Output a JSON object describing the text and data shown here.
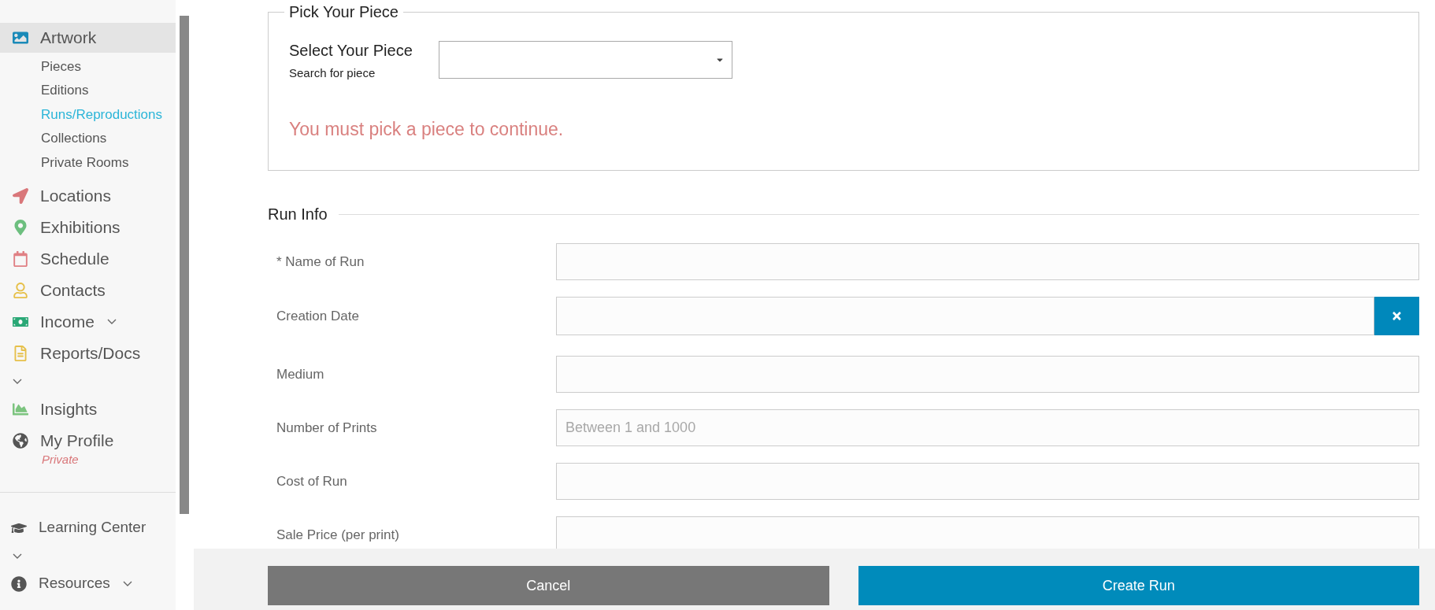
{
  "sidebar": {
    "items": [
      {
        "label": "Artwork",
        "selected": true,
        "expandable": false,
        "children": [
          {
            "label": "Pieces",
            "selected": false
          },
          {
            "label": "Editions",
            "selected": false
          },
          {
            "label": "Runs/Reproductions",
            "selected": true
          },
          {
            "label": "Collections",
            "selected": false
          },
          {
            "label": "Private Rooms",
            "selected": false
          }
        ]
      },
      {
        "label": "Locations",
        "selected": false,
        "expandable": false
      },
      {
        "label": "Exhibitions",
        "selected": false,
        "expandable": false
      },
      {
        "label": "Schedule",
        "selected": false,
        "expandable": false
      },
      {
        "label": "Contacts",
        "selected": false,
        "expandable": false
      },
      {
        "label": "Income",
        "selected": false,
        "expandable": true
      },
      {
        "label": "Reports/Docs",
        "selected": false,
        "expandable": true
      },
      {
        "label": "Insights",
        "selected": false,
        "expandable": false
      },
      {
        "label": "My Profile",
        "selected": false,
        "expandable": false,
        "status": "Private"
      }
    ],
    "footer_items": [
      {
        "label": "Learning Center",
        "expandable": true
      },
      {
        "label": "Resources",
        "expandable": true
      }
    ]
  },
  "pick_piece": {
    "legend": "Pick Your Piece",
    "label": "Select Your Piece",
    "hint": "Search for piece",
    "error": "You must pick a piece to continue."
  },
  "run_info": {
    "title": "Run Info",
    "fields": [
      {
        "label": "* Name of Run",
        "clear_button": false
      },
      {
        "label": "Creation Date",
        "clear_button": true
      },
      {
        "label": "Medium",
        "clear_button": false
      },
      {
        "label": "Number of Prints",
        "placeholder": "Between 1 and 1000",
        "clear_button": false
      },
      {
        "label": "Cost of Run",
        "clear_button": false
      },
      {
        "label": "Sale Price (per print)",
        "clear_button": false
      }
    ]
  },
  "actions": [
    {
      "label": "Cancel",
      "kind": "secondary"
    },
    {
      "label": "Create Run",
      "kind": "primary"
    }
  ]
}
